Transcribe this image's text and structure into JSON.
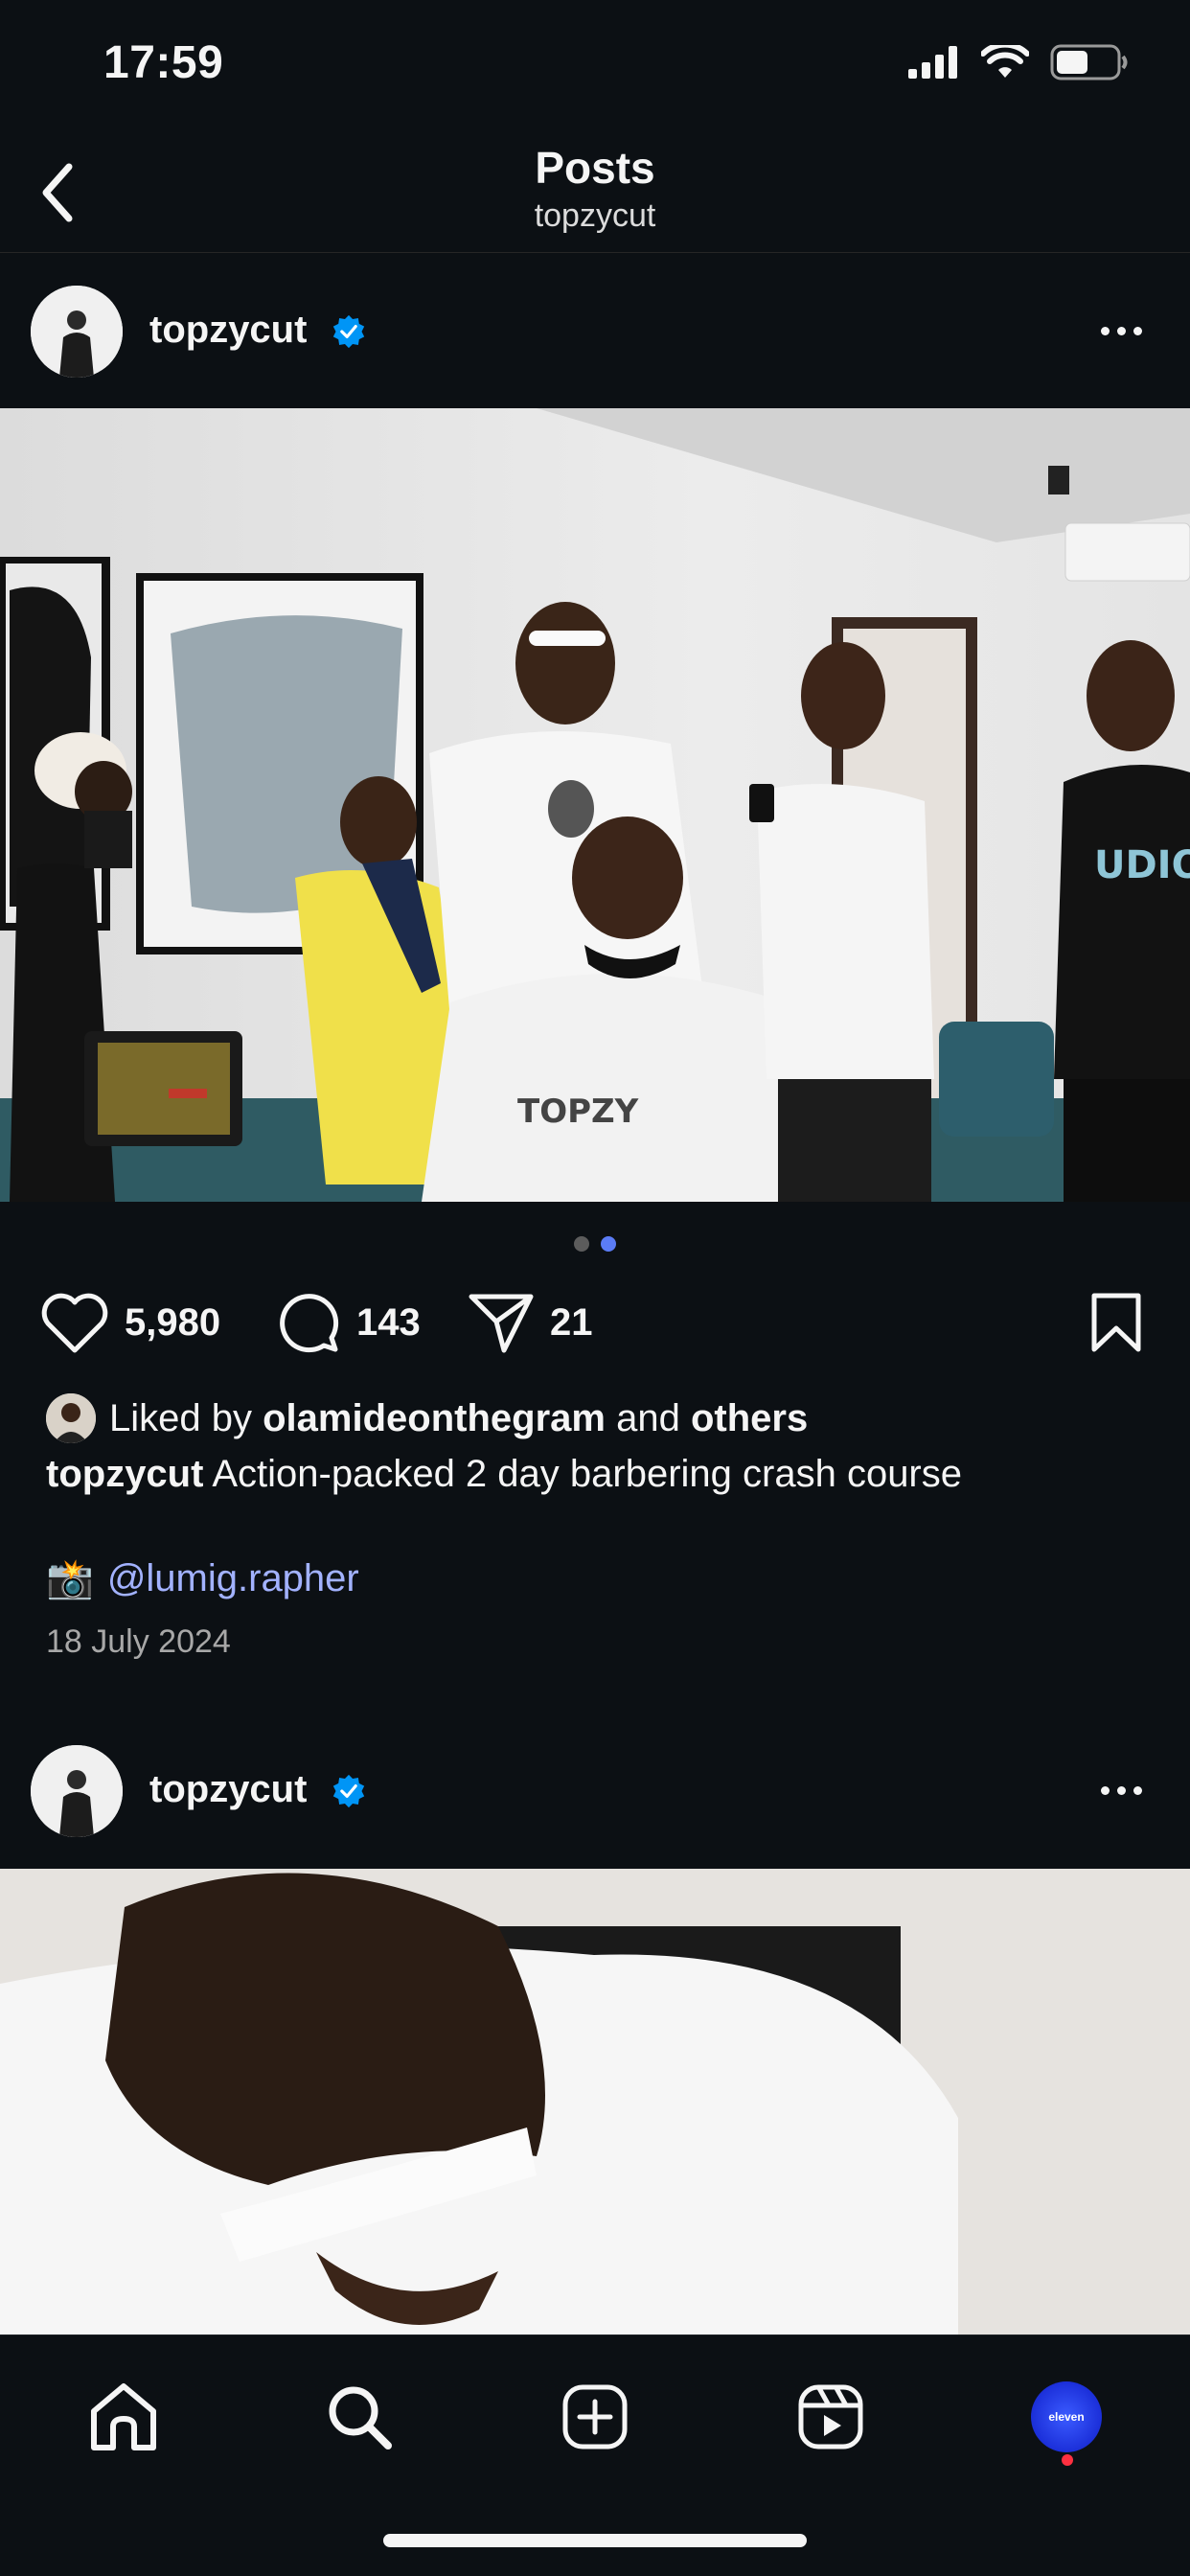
{
  "status": {
    "time": "17:59",
    "signal_icon": "cellular-signal-icon",
    "wifi_icon": "wifi-icon",
    "battery_icon": "battery-icon"
  },
  "header": {
    "title": "Posts",
    "subtitle": "topzycut",
    "back_icon": "chevron-left-icon"
  },
  "posts": [
    {
      "username": "topzycut",
      "verified": true,
      "carousel": {
        "count": 2,
        "active_index": 1
      },
      "likes": "5,980",
      "comments": "143",
      "shares": "21",
      "liked_by_prefix": "Liked by",
      "liked_by_user": "olamideonthegram",
      "liked_by_and": "and",
      "liked_by_others": "others",
      "caption_user": "topzycut",
      "caption_text": "Action-packed 2 day barbering crash course",
      "camera_emoji": "📸",
      "mention": "@lumig.rapher",
      "date": "18 July 2024"
    },
    {
      "username": "topzycut",
      "verified": true
    }
  ],
  "bottom_nav": {
    "items": [
      "home-icon",
      "search-icon",
      "create-icon",
      "reels-icon",
      "profile-avatar"
    ],
    "profile_label": "eleven"
  },
  "colors": {
    "background": "#0c1014",
    "verified_blue": "#0095f6",
    "mention": "#a2b2ff",
    "carousel_active": "#5b7cf5",
    "notification_red": "#ff3040"
  }
}
